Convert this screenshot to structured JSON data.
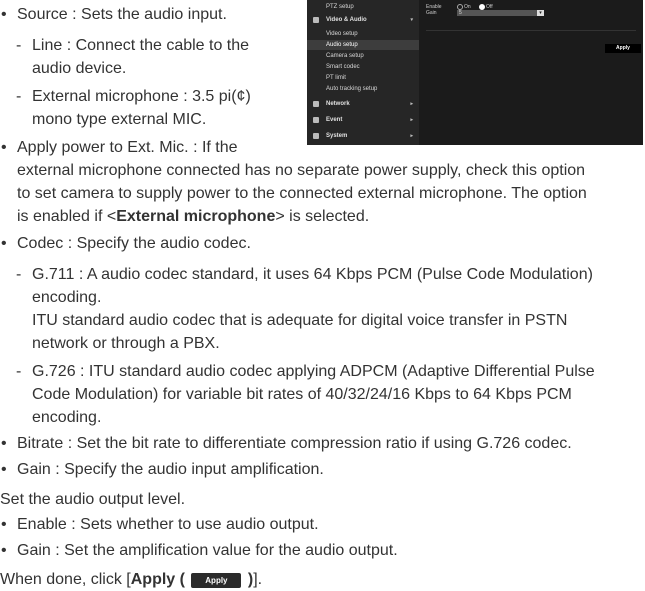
{
  "screenshot": {
    "menu": {
      "top_item": "PTZ setup",
      "section": "Video & Audio",
      "sub_items": [
        "Video setup",
        "Audio setup",
        "Camera setup",
        "Smart codec",
        "PT limit",
        "Auto tracking setup"
      ],
      "selected_index": 1,
      "categories": [
        "Network",
        "Event",
        "System"
      ]
    },
    "form": {
      "enable_label": "Enable",
      "gain_label": "Gain",
      "on_label": "On",
      "off_label": "Off",
      "gain_value": "5",
      "apply_label": "Apply"
    }
  },
  "doc": {
    "source_text": "Source : Sets the audio input.",
    "line_1": "Line : Connect the cable to the",
    "line_2": "audio device.",
    "extmic_1": "External microphone : 3.5 pi(¢)",
    "extmic_2": "mono type external MIC.",
    "apply_power_1": "Apply power to Ext. Mic. : If the",
    "apply_power_2": "external microphone connected has no separate power supply, check this option",
    "apply_power_3": "to set camera to supply power to the connected external microphone. The option",
    "apply_power_4_pre": "is enabled if <",
    "apply_power_4_bold": "External microphone",
    "apply_power_4_post": "> is selected.",
    "codec_text": "Codec : Specify the audio codec.",
    "g711_1": "G.711 : A audio codec standard, it uses 64 Kbps PCM (Pulse Code Modulation)",
    "g711_2": "encoding.",
    "g711_3": "ITU standard audio codec that is adequate for digital voice transfer in PSTN",
    "g711_4": "network or through a PBX.",
    "g726_1": "G.726 : ITU standard audio codec applying ADPCM (Adaptive Differential Pulse",
    "g726_2": "Code Modulation) for variable bit rates of 40/32/24/16 Kbps to 64 Kbps PCM",
    "g726_3": "encoding.",
    "bitrate_text": "Bitrate : Set the bit rate to differentiate compression ratio if using G.726 codec.",
    "gain_text": "Gain : Specify the audio input amplification.",
    "output_level": "Set the audio output level.",
    "enable_text": "Enable : Sets whether to use audio output.",
    "out_gain_text": "Gain : Set the amplification value for the audio output.",
    "when_done_pre": "When done, click [",
    "when_done_bold": "Apply (",
    "when_done_bold_close": ")",
    "when_done_post": "].",
    "apply_button_label": "Apply"
  }
}
